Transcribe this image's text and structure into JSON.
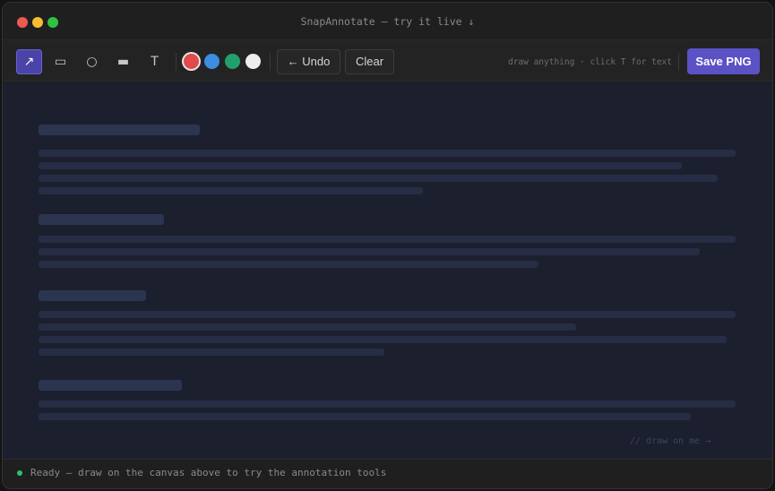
{
  "window": {
    "title": "SnapAnnotate — try it live ↓"
  },
  "toolbar": {
    "tools": [
      {
        "name": "arrow",
        "glyph": "↗",
        "active": true
      },
      {
        "name": "rectangle",
        "glyph": "▭",
        "active": false
      },
      {
        "name": "ellipse",
        "glyph": "○",
        "active": false
      },
      {
        "name": "highlighter",
        "glyph": "▬",
        "active": false
      },
      {
        "name": "text",
        "glyph": "T",
        "active": false
      }
    ],
    "colors": [
      {
        "name": "red",
        "hex": "#e04a4a",
        "selected": true
      },
      {
        "name": "blue",
        "hex": "#3b8ee0",
        "selected": false
      },
      {
        "name": "green",
        "hex": "#22a06b",
        "selected": false
      },
      {
        "name": "white",
        "hex": "#eeeeee",
        "selected": false
      }
    ],
    "undo_label": "← Undo",
    "clear_label": "Clear",
    "hint": "draw anything · click T for text",
    "save_label": "Save PNG"
  },
  "canvas": {
    "hint": "// draw on me →"
  },
  "status": {
    "text": "Ready — draw on the canvas above to try the annotation tools",
    "indicator_color": "#2fbf71"
  },
  "colors": {
    "accent": "#5b52c5",
    "canvas_bg": "#1c1f2d"
  }
}
